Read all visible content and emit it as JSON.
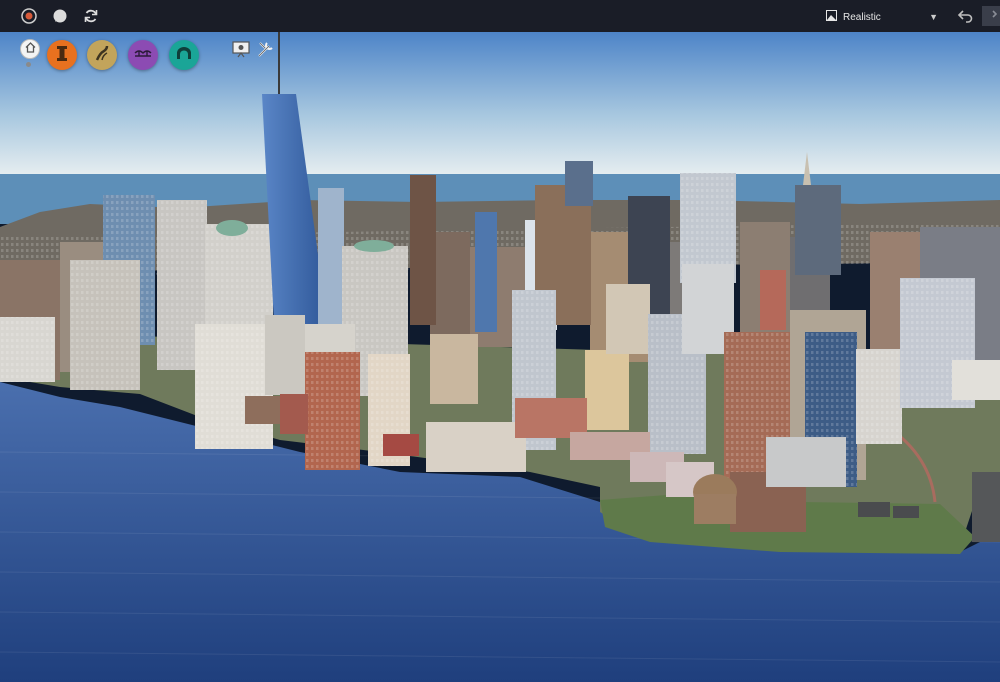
{
  "toolbar": {
    "left_icons": [
      "user-icon",
      "chat-icon",
      "refresh-icon"
    ],
    "render_mode": {
      "label": "Realistic",
      "icon": "image-icon",
      "caret": "chevron-down-icon"
    },
    "right_icons": [
      "undo-icon",
      "redo-icon"
    ]
  },
  "tools": {
    "home": {
      "icon": "home-icon"
    },
    "layers": [
      {
        "name": "landmarks-layer",
        "icon": "tower-icon",
        "color": "#e8711f"
      },
      {
        "name": "roads-layer",
        "icon": "road-icon",
        "color": "#c2a45b"
      },
      {
        "name": "bridges-layer",
        "icon": "bridge-icon",
        "color": "#8c4bb3"
      },
      {
        "name": "tunnels-layer",
        "icon": "tunnel-icon",
        "color": "#1aa597"
      }
    ],
    "extra": [
      {
        "name": "presentation-button",
        "icon": "presentation-icon"
      },
      {
        "name": "tools-button",
        "icon": "tools-icon"
      }
    ]
  },
  "colors": {
    "toolbar_bg": "#1a1d27",
    "sky_top": "#4b83c9",
    "sky_horizon": "#e9f0f3",
    "water": "#2e4f8c"
  }
}
